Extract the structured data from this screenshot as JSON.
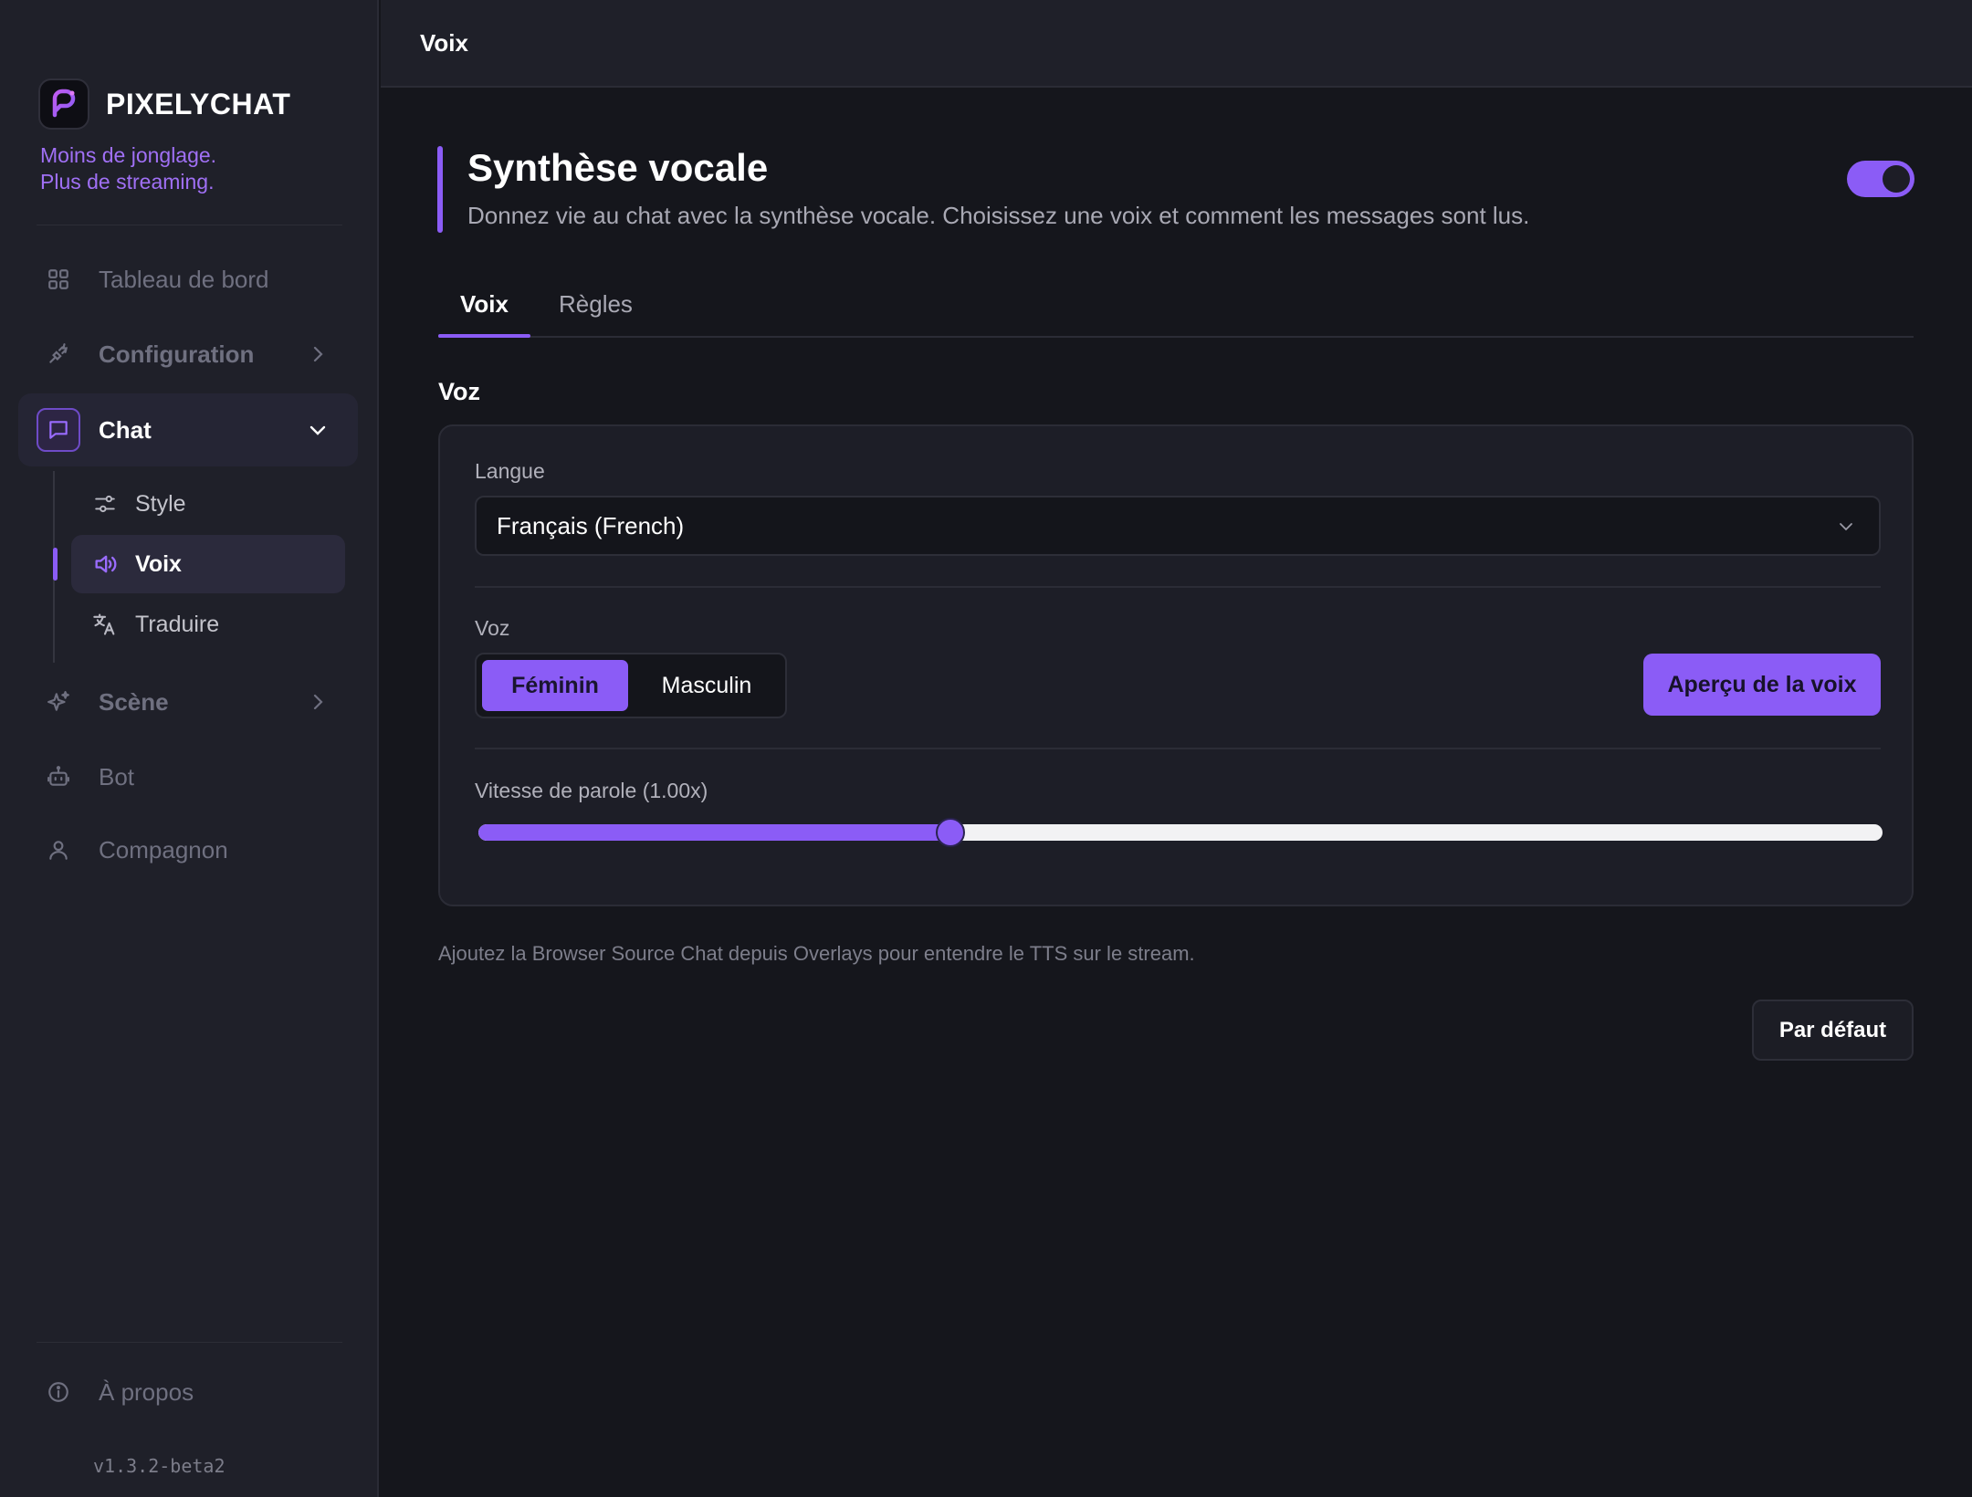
{
  "brand": {
    "name": "PIXELYCHAT",
    "tagline_line1": "Moins de jonglage.",
    "tagline_line2": "Plus de streaming."
  },
  "sidebar": {
    "items": [
      {
        "label": "Tableau de bord",
        "icon": "grid-icon"
      },
      {
        "label": "Configuration",
        "icon": "plug-icon"
      },
      {
        "label": "Chat",
        "icon": "chat-bubble-icon"
      },
      {
        "label": "Scène",
        "icon": "sparkle-icon"
      },
      {
        "label": "Bot",
        "icon": "robot-icon"
      },
      {
        "label": "Compagnon",
        "icon": "user-icon"
      }
    ],
    "chat_sub_items": [
      {
        "label": "Style",
        "icon": "sliders-icon"
      },
      {
        "label": "Voix",
        "icon": "speaker-icon"
      },
      {
        "label": "Traduire",
        "icon": "translate-icon"
      }
    ],
    "about": {
      "label": "À propos",
      "icon": "info-icon"
    },
    "version": "v1.3.2-beta2"
  },
  "header": {
    "title": "Voix"
  },
  "main": {
    "title": "Synthèse vocale",
    "subtitle": "Donnez vie au chat avec la synthèse vocale. Choisissez une voix et comment les messages sont lus.",
    "enabled": true,
    "tabs": [
      {
        "label": "Voix",
        "active": true
      },
      {
        "label": "Règles",
        "active": false
      }
    ],
    "section_title": "Voz",
    "language": {
      "label": "Langue",
      "value": "Français (French)"
    },
    "voice": {
      "label": "Voz",
      "options": [
        "Féminin",
        "Masculin"
      ],
      "selected": "Féminin",
      "preview_label": "Aperçu de la voix"
    },
    "speed": {
      "label": "Vitesse de parole (1.00x)",
      "value": 1.0,
      "fill_fraction": 0.336
    },
    "note": "Ajoutez la Browser Source Chat depuis Overlays pour entendre le TTS sur le stream.",
    "default_button": "Par défaut"
  },
  "colors": {
    "accent": "#8b5cf6",
    "background": "#15161c",
    "sidebar": "#1f2029"
  }
}
